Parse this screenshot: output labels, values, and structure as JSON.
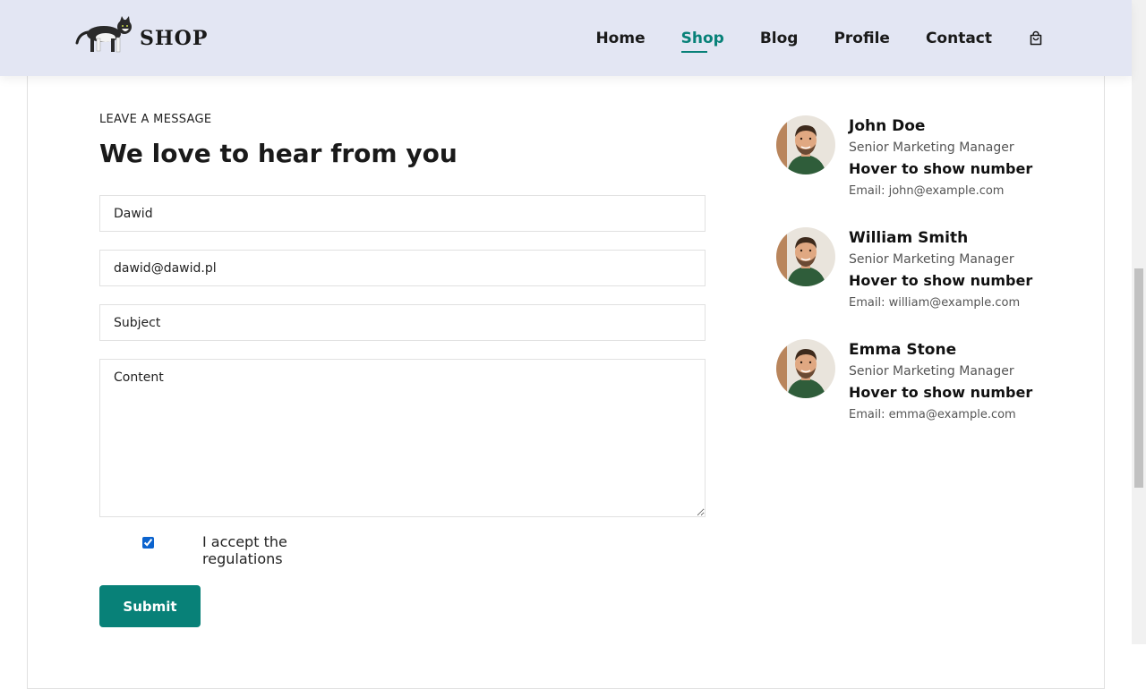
{
  "header": {
    "logo_text": "SHOP",
    "nav": [
      {
        "label": "Home",
        "active": false
      },
      {
        "label": "Shop",
        "active": true
      },
      {
        "label": "Blog",
        "active": false
      },
      {
        "label": "Profile",
        "active": false
      },
      {
        "label": "Contact",
        "active": false
      }
    ],
    "cart_icon": "shopping-bag-icon"
  },
  "form": {
    "eyebrow": "LEAVE A MESSAGE",
    "headline": "We love to hear from you",
    "name_value": "Dawid",
    "email_value": "dawid@dawid.pl",
    "subject_placeholder": "Subject",
    "content_placeholder": "Content",
    "accept_label": "I accept the regulations",
    "accept_checked": true,
    "submit_label": "Submit"
  },
  "people": [
    {
      "name": "John Doe",
      "role": "Senior Marketing Manager",
      "phone_text": "Hover to show number",
      "email": "Email: john@example.com"
    },
    {
      "name": "William Smith",
      "role": "Senior Marketing Manager",
      "phone_text": "Hover to show number",
      "email": "Email: william@example.com"
    },
    {
      "name": "Emma Stone",
      "role": "Senior Marketing Manager",
      "phone_text": "Hover to show number",
      "email": "Email: emma@example.com"
    }
  ],
  "colors": {
    "accent": "#088178",
    "header_bg": "#e3e6f3",
    "checkbox": "#0b63ce"
  }
}
